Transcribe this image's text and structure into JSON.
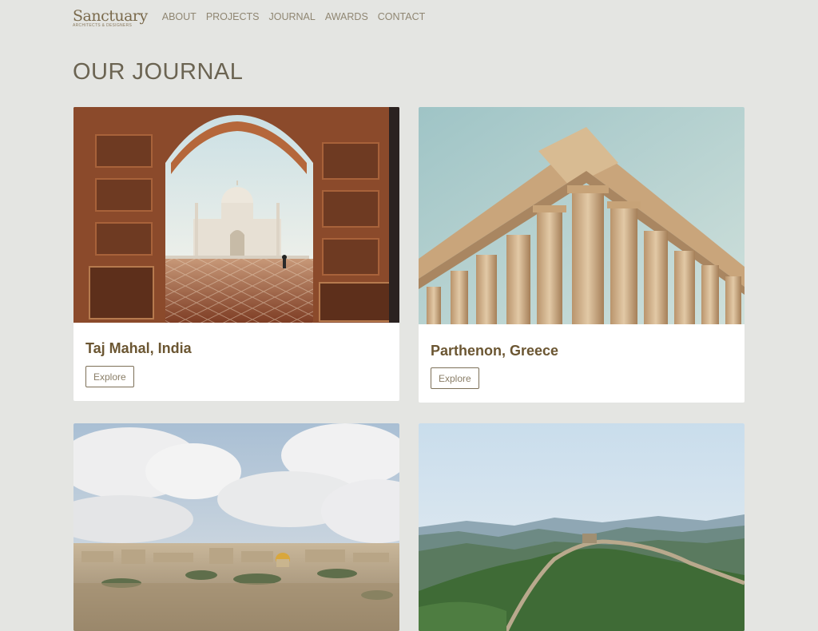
{
  "brand": {
    "name": "Sanctuary",
    "tagline": "ARCHITECTS & DESIGNERS"
  },
  "nav": [
    "ABOUT",
    "PROJECTS",
    "JOURNAL",
    "AWARDS",
    "CONTACT"
  ],
  "page_title": "OUR JOURNAL",
  "cards": [
    {
      "title": "Taj Mahal, India",
      "button": "Explore"
    },
    {
      "title": "Parthenon, Greece",
      "button": "Explore"
    },
    {
      "title": "",
      "button": ""
    },
    {
      "title": "",
      "button": ""
    }
  ],
  "colors": {
    "background": "#e4e5e2",
    "accent": "#6b5632",
    "nav": "#8f8672"
  }
}
